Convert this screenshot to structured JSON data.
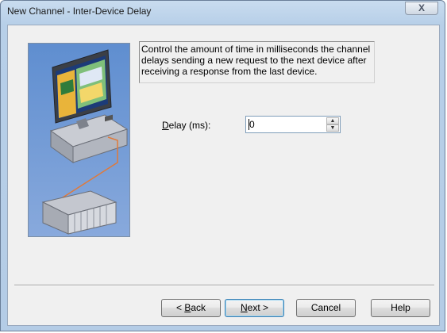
{
  "window": {
    "title": "New Channel - Inter-Device Delay",
    "close_symbol": "X"
  },
  "info": {
    "text": "Control the amount of time in milliseconds the channel delays sending a new request to the next device after receiving a response from the last device."
  },
  "delay": {
    "label_prefix": "",
    "label_accel": "D",
    "label_rest": "elay (ms):",
    "value": "0"
  },
  "buttons": {
    "back_prefix": "< ",
    "back_accel": "B",
    "back_rest": "ack",
    "next_accel": "N",
    "next_rest": "ext >",
    "cancel": "Cancel",
    "help": "Help"
  },
  "icons": {
    "illustration": "computer-network-illustration",
    "spin_up": "spin-up-icon",
    "spin_down": "spin-down-icon"
  }
}
